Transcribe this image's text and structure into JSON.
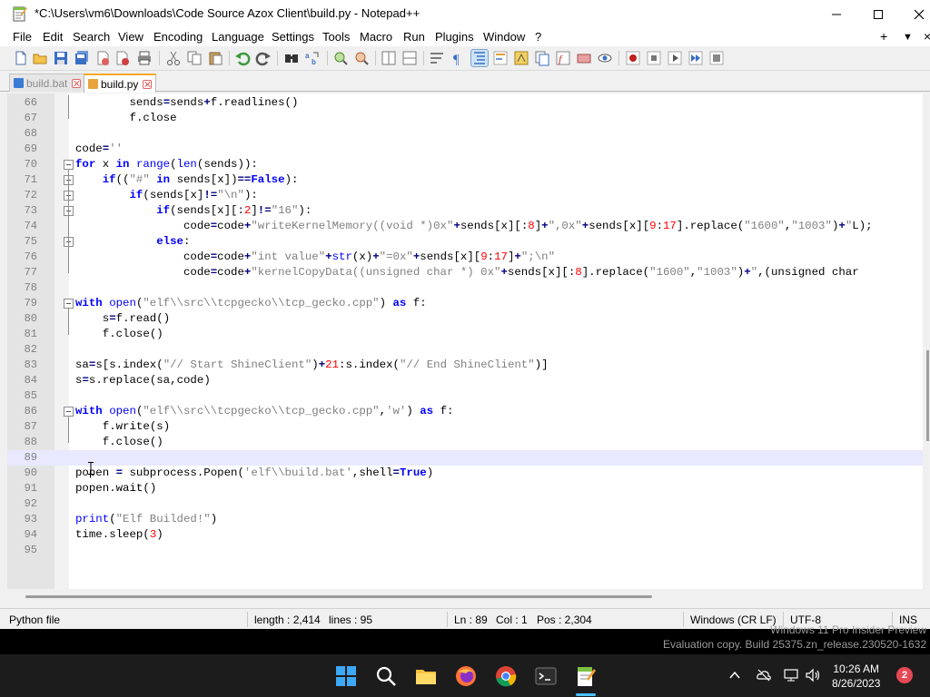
{
  "window": {
    "title": "*C:\\Users\\vm6\\Downloads\\Code Source Azox Client\\build.py - Notepad++"
  },
  "menu": {
    "items": [
      "File",
      "Edit",
      "Search",
      "View",
      "Encoding",
      "Language",
      "Settings",
      "Tools",
      "Macro",
      "Run",
      "Plugins",
      "Window",
      "?"
    ],
    "right": [
      "+",
      "▼",
      "×"
    ]
  },
  "toolbar": {
    "icons": [
      "new-file-icon",
      "open-file-icon",
      "save-icon",
      "save-all-icon",
      "close-icon",
      "close-all-icon",
      "print-icon",
      "cut-icon",
      "copy-icon",
      "paste-icon",
      "undo-icon",
      "redo-icon",
      "find-icon",
      "replace-icon",
      "zoom-in-icon",
      "zoom-out-icon",
      "sync-vertical-icon",
      "sync-horizontal-icon",
      "word-wrap-icon",
      "show-all-chars-icon",
      "indent-guide-icon",
      "udl-icon",
      "doc-map-icon",
      "function-list-icon",
      "folder-workspace-icon",
      "doc-switcher-icon",
      "monitor-icon",
      "record-macro-icon",
      "stop-record-icon",
      "play-macro-icon",
      "run-macro-multiple-icon",
      "save-macro-icon"
    ]
  },
  "tabs": [
    {
      "label": "build.bat",
      "active": false,
      "color": "#3c7bd4"
    },
    {
      "label": "build.py",
      "active": true,
      "color": "#e8a33c"
    }
  ],
  "editor": {
    "current_line": 89,
    "lines": [
      {
        "n": "66",
        "html": "        sends=sends+f.readlines()"
      },
      {
        "n": "67",
        "html": "        f.close"
      },
      {
        "n": "68",
        "html": ""
      },
      {
        "n": "69",
        "html": "code=''"
      },
      {
        "n": "70",
        "html": "for x in range(len(sends)):"
      },
      {
        "n": "71",
        "html": "    if((\"#\" in sends[x])==False):"
      },
      {
        "n": "72",
        "html": "        if(sends[x]!=\"\\n\"):"
      },
      {
        "n": "73",
        "html": "            if(sends[x][:2]!=\"16\"):"
      },
      {
        "n": "74",
        "html": "                code=code+\"writeKernelMemory((void *)0x\"+sends[x][:8]+\",0x\"+sends[x][9:17].replace(\"1600\",\"1003\")+\"L);"
      },
      {
        "n": "75",
        "html": "            else:"
      },
      {
        "n": "76",
        "html": "                code=code+\"int value\"+str(x)+\"=0x\"+sends[x][9:17]+\";\\n\""
      },
      {
        "n": "77",
        "html": "                code=code+\"kernelCopyData((unsigned char *) 0x\"+sends[x][:8].replace(\"1600\",\"1003\")+\",(unsigned char"
      },
      {
        "n": "78",
        "html": ""
      },
      {
        "n": "79",
        "html": "with open(\"elf\\\\src\\\\tcpgecko\\\\tcp_gecko.cpp\") as f:"
      },
      {
        "n": "80",
        "html": "    s=f.read()"
      },
      {
        "n": "81",
        "html": "    f.close()"
      },
      {
        "n": "82",
        "html": ""
      },
      {
        "n": "83",
        "html": "sa=s[s.index(\"// Start ShineClient\")+21:s.index(\"// End ShineClient\")]"
      },
      {
        "n": "84",
        "html": "s=s.replace(sa,code)"
      },
      {
        "n": "85",
        "html": ""
      },
      {
        "n": "86",
        "html": "with open(\"elf\\\\src\\\\tcpgecko\\\\tcp_gecko.cpp\",'w') as f:"
      },
      {
        "n": "87",
        "html": "    f.write(s)"
      },
      {
        "n": "88",
        "html": "    f.close()"
      },
      {
        "n": "89",
        "html": ""
      },
      {
        "n": "90",
        "html": "popen = subprocess.Popen('elf\\\\build.bat',shell=True)"
      },
      {
        "n": "91",
        "html": "popen.wait()"
      },
      {
        "n": "92",
        "html": ""
      },
      {
        "n": "93",
        "html": "print(\"Elf Builded!\")"
      },
      {
        "n": "94",
        "html": "time.sleep(3)"
      },
      {
        "n": "95",
        "html": ""
      }
    ]
  },
  "status": {
    "file_type": "Python file",
    "length": "length : 2,414",
    "lines": "lines : 95",
    "ln": "Ln : 89",
    "col": "Col : 1",
    "pos": "Pos : 2,304",
    "eol": "Windows (CR LF)",
    "encoding": "UTF-8",
    "mode": "INS"
  },
  "watermark": {
    "line1": "Windows 11 Pro Insider Preview",
    "line2": "Evaluation copy. Build 25375.zn_release.230520-1632"
  },
  "taskbar": {
    "apps": [
      "start-icon",
      "search-icon",
      "file-explorer-icon",
      "firefox-icon",
      "chrome-icon",
      "terminal-icon",
      "notepad-plus-plus-icon"
    ],
    "time": "10:26 AM",
    "date": "8/26/2023",
    "notification_count": "2"
  }
}
